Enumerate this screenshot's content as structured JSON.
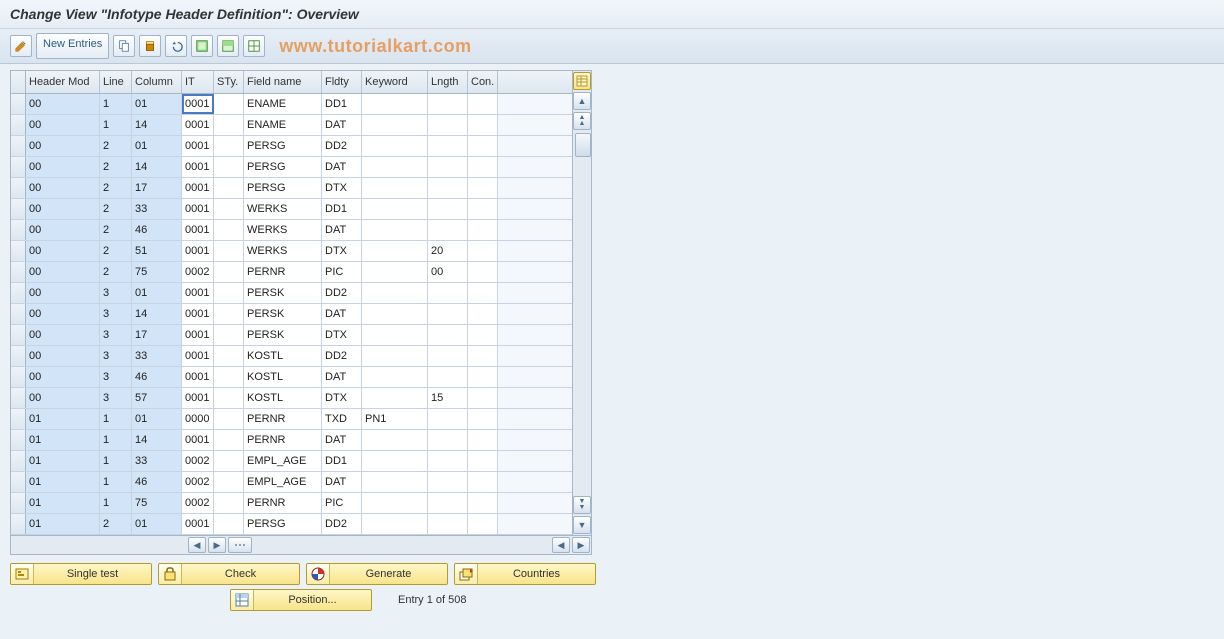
{
  "title": "Change View \"Infotype Header Definition\": Overview",
  "toolbar": {
    "new_entries": "New Entries"
  },
  "watermark": "www.tutorialkart.com",
  "columns": {
    "hmod": "Header Mod",
    "line": "Line",
    "col": "Column",
    "it": "IT",
    "sty": "STy.",
    "fname": "Field name",
    "fldty": "Fldty",
    "key": "Keyword",
    "lngth": "Lngth",
    "con": "Con."
  },
  "rows": [
    {
      "hmod": "00",
      "line": "1",
      "col": "01",
      "it": "0001",
      "sty": "",
      "fname": "ENAME",
      "fldty": "DD1",
      "key": "",
      "lngth": "",
      "con": ""
    },
    {
      "hmod": "00",
      "line": "1",
      "col": "14",
      "it": "0001",
      "sty": "",
      "fname": "ENAME",
      "fldty": "DAT",
      "key": "",
      "lngth": "",
      "con": ""
    },
    {
      "hmod": "00",
      "line": "2",
      "col": "01",
      "it": "0001",
      "sty": "",
      "fname": "PERSG",
      "fldty": "DD2",
      "key": "",
      "lngth": "",
      "con": ""
    },
    {
      "hmod": "00",
      "line": "2",
      "col": "14",
      "it": "0001",
      "sty": "",
      "fname": "PERSG",
      "fldty": "DAT",
      "key": "",
      "lngth": "",
      "con": ""
    },
    {
      "hmod": "00",
      "line": "2",
      "col": "17",
      "it": "0001",
      "sty": "",
      "fname": "PERSG",
      "fldty": "DTX",
      "key": "",
      "lngth": "",
      "con": ""
    },
    {
      "hmod": "00",
      "line": "2",
      "col": "33",
      "it": "0001",
      "sty": "",
      "fname": "WERKS",
      "fldty": "DD1",
      "key": "",
      "lngth": "",
      "con": ""
    },
    {
      "hmod": "00",
      "line": "2",
      "col": "46",
      "it": "0001",
      "sty": "",
      "fname": "WERKS",
      "fldty": "DAT",
      "key": "",
      "lngth": "",
      "con": ""
    },
    {
      "hmod": "00",
      "line": "2",
      "col": "51",
      "it": "0001",
      "sty": "",
      "fname": "WERKS",
      "fldty": "DTX",
      "key": "",
      "lngth": "20",
      "con": ""
    },
    {
      "hmod": "00",
      "line": "2",
      "col": "75",
      "it": "0002",
      "sty": "",
      "fname": "PERNR",
      "fldty": "PIC",
      "key": "",
      "lngth": "00",
      "con": ""
    },
    {
      "hmod": "00",
      "line": "3",
      "col": "01",
      "it": "0001",
      "sty": "",
      "fname": "PERSK",
      "fldty": "DD2",
      "key": "",
      "lngth": "",
      "con": ""
    },
    {
      "hmod": "00",
      "line": "3",
      "col": "14",
      "it": "0001",
      "sty": "",
      "fname": "PERSK",
      "fldty": "DAT",
      "key": "",
      "lngth": "",
      "con": ""
    },
    {
      "hmod": "00",
      "line": "3",
      "col": "17",
      "it": "0001",
      "sty": "",
      "fname": "PERSK",
      "fldty": "DTX",
      "key": "",
      "lngth": "",
      "con": ""
    },
    {
      "hmod": "00",
      "line": "3",
      "col": "33",
      "it": "0001",
      "sty": "",
      "fname": "KOSTL",
      "fldty": "DD2",
      "key": "",
      "lngth": "",
      "con": ""
    },
    {
      "hmod": "00",
      "line": "3",
      "col": "46",
      "it": "0001",
      "sty": "",
      "fname": "KOSTL",
      "fldty": "DAT",
      "key": "",
      "lngth": "",
      "con": ""
    },
    {
      "hmod": "00",
      "line": "3",
      "col": "57",
      "it": "0001",
      "sty": "",
      "fname": "KOSTL",
      "fldty": "DTX",
      "key": "",
      "lngth": "15",
      "con": ""
    },
    {
      "hmod": "01",
      "line": "1",
      "col": "01",
      "it": "0000",
      "sty": "",
      "fname": "PERNR",
      "fldty": "TXD",
      "key": "PN1",
      "lngth": "",
      "con": ""
    },
    {
      "hmod": "01",
      "line": "1",
      "col": "14",
      "it": "0001",
      "sty": "",
      "fname": "PERNR",
      "fldty": "DAT",
      "key": "",
      "lngth": "",
      "con": ""
    },
    {
      "hmod": "01",
      "line": "1",
      "col": "33",
      "it": "0002",
      "sty": "",
      "fname": "EMPL_AGE",
      "fldty": "DD1",
      "key": "",
      "lngth": "",
      "con": ""
    },
    {
      "hmod": "01",
      "line": "1",
      "col": "46",
      "it": "0002",
      "sty": "",
      "fname": "EMPL_AGE",
      "fldty": "DAT",
      "key": "",
      "lngth": "",
      "con": ""
    },
    {
      "hmod": "01",
      "line": "1",
      "col": "75",
      "it": "0002",
      "sty": "",
      "fname": "PERNR",
      "fldty": "PIC",
      "key": "",
      "lngth": "",
      "con": ""
    },
    {
      "hmod": "01",
      "line": "2",
      "col": "01",
      "it": "0001",
      "sty": "",
      "fname": "PERSG",
      "fldty": "DD2",
      "key": "",
      "lngth": "",
      "con": ""
    }
  ],
  "actions": {
    "single_test": "Single test",
    "check": "Check",
    "generate": "Generate",
    "countries": "Countries",
    "position": "Position..."
  },
  "status": "Entry 1 of 508"
}
